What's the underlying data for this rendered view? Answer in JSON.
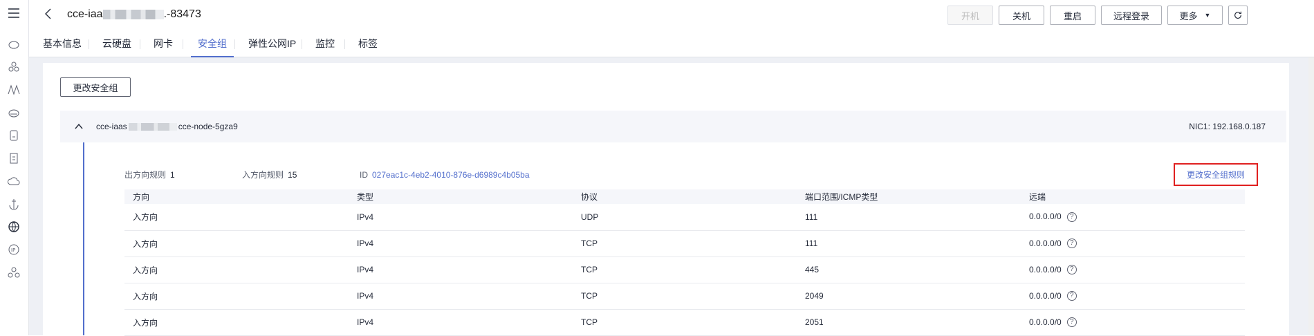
{
  "header": {
    "title_prefix": "cce-iaa",
    "title_suffix": ".-83473",
    "buttons": {
      "start": "开机",
      "shutdown": "关机",
      "restart": "重启",
      "remote_login": "远程登录",
      "more": "更多"
    }
  },
  "tabs": [
    "基本信息",
    "云硬盘",
    "网卡",
    "安全组",
    "弹性公网IP",
    "监控",
    "标签"
  ],
  "active_tab": "安全组",
  "change_sg_button": "更改安全组",
  "security_group": {
    "name_prefix": "cce-iaas",
    "name_suffix": "cce-node-5gza9",
    "nic": "NIC1: 192.168.0.187",
    "outbound_label": "出方向规则",
    "outbound_count": "1",
    "inbound_label": "入方向规则",
    "inbound_count": "15",
    "id_label": "ID",
    "id_value": "027eac1c-4eb2-4010-876e-d6989c4b05ba",
    "change_rules_link": "更改安全组规则"
  },
  "table": {
    "headers": [
      "方向",
      "类型",
      "协议",
      "端口范围/ICMP类型",
      "远端"
    ],
    "rows": [
      [
        "入方向",
        "IPv4",
        "UDP",
        "111",
        "0.0.0.0/0"
      ],
      [
        "入方向",
        "IPv4",
        "TCP",
        "111",
        "0.0.0.0/0"
      ],
      [
        "入方向",
        "IPv4",
        "TCP",
        "445",
        "0.0.0.0/0"
      ],
      [
        "入方向",
        "IPv4",
        "TCP",
        "2049",
        "0.0.0.0/0"
      ],
      [
        "入方向",
        "IPv4",
        "TCP",
        "2051",
        "0.0.0.0/0"
      ]
    ]
  },
  "colors": {
    "accent": "#526ecc",
    "highlight_border": "#e02020"
  }
}
